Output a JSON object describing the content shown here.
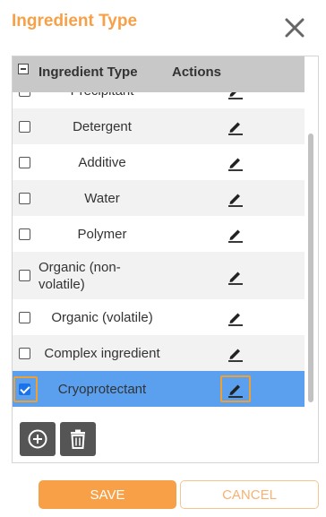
{
  "dialog": {
    "title": "Ingredient Type",
    "close_icon": "close-icon"
  },
  "table": {
    "columns": [
      "Ingredient Type",
      "Actions"
    ],
    "rows": [
      {
        "name": "Precipitant",
        "checked": false,
        "alt": false,
        "selected": false,
        "clipped": true
      },
      {
        "name": "Detergent",
        "checked": false,
        "alt": true,
        "selected": false
      },
      {
        "name": "Additive",
        "checked": false,
        "alt": false,
        "selected": false
      },
      {
        "name": "Water",
        "checked": false,
        "alt": true,
        "selected": false
      },
      {
        "name": "Polymer",
        "checked": false,
        "alt": false,
        "selected": false
      },
      {
        "name": "Organic (non-volatile)",
        "checked": false,
        "alt": true,
        "selected": false
      },
      {
        "name": "Organic (volatile)",
        "checked": false,
        "alt": false,
        "selected": false
      },
      {
        "name": "Complex ingredient",
        "checked": false,
        "alt": true,
        "selected": false
      },
      {
        "name": "Cryoprotectant",
        "checked": true,
        "alt": false,
        "selected": true
      }
    ],
    "edit_icon": "pencil-icon"
  },
  "toolbar": {
    "add_icon": "plus-circle-icon",
    "delete_icon": "trash-icon"
  },
  "footer": {
    "save_label": "SAVE",
    "cancel_label": "CANCEL"
  },
  "colors": {
    "accent": "#f7a047",
    "selected_row": "#5aa0ef",
    "header_bg": "#c8c8c8"
  }
}
